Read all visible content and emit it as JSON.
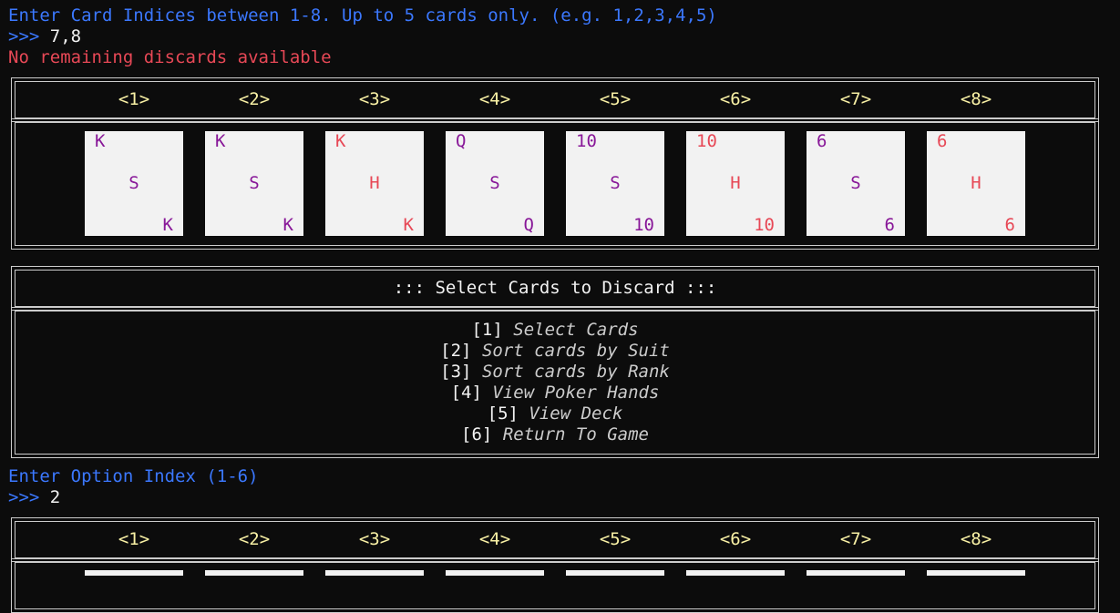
{
  "terminal": {
    "prompt_line": "Enter Card Indices between 1-8. Up to 5 cards only. (e.g. 1,2,3,4,5)",
    "prompt_symbol": ">>> ",
    "input_1": "7,8",
    "error_line": "No remaining discards available",
    "option_prompt": "Enter Option Index (1-6)",
    "input_2": "2"
  },
  "hand": {
    "indices": [
      "<1>",
      "<2>",
      "<3>",
      "<4>",
      "<5>",
      "<6>",
      "<7>",
      "<8>"
    ],
    "cards": [
      {
        "rank": "K",
        "suit": "S",
        "color": "spade"
      },
      {
        "rank": "K",
        "suit": "S",
        "color": "spade"
      },
      {
        "rank": "K",
        "suit": "H",
        "color": "heart"
      },
      {
        "rank": "Q",
        "suit": "S",
        "color": "spade"
      },
      {
        "rank": "10",
        "suit": "S",
        "color": "spade"
      },
      {
        "rank": "10",
        "suit": "H",
        "color": "heart"
      },
      {
        "rank": "6",
        "suit": "S",
        "color": "spade"
      },
      {
        "rank": "6",
        "suit": "H",
        "color": "heart"
      }
    ]
  },
  "menu": {
    "title": "::: Select Cards to Discard :::",
    "options": [
      {
        "num": "[1]",
        "label": "Select Cards"
      },
      {
        "num": "[2]",
        "label": "Sort cards by Suit"
      },
      {
        "num": "[3]",
        "label": "Sort cards by Rank"
      },
      {
        "num": "[4]",
        "label": "View Poker Hands"
      },
      {
        "num": "[5]",
        "label": "View Deck"
      },
      {
        "num": "[6]",
        "label": "Return To Game"
      }
    ]
  },
  "colors": {
    "background": "#0c0c0c",
    "prompt_blue": "#3b78ff",
    "error_red": "#e74856",
    "index_yellow": "#f9f1a5",
    "spade_purple": "#881798",
    "heart_red": "#e74856",
    "card_bg": "#f2f2f2"
  }
}
